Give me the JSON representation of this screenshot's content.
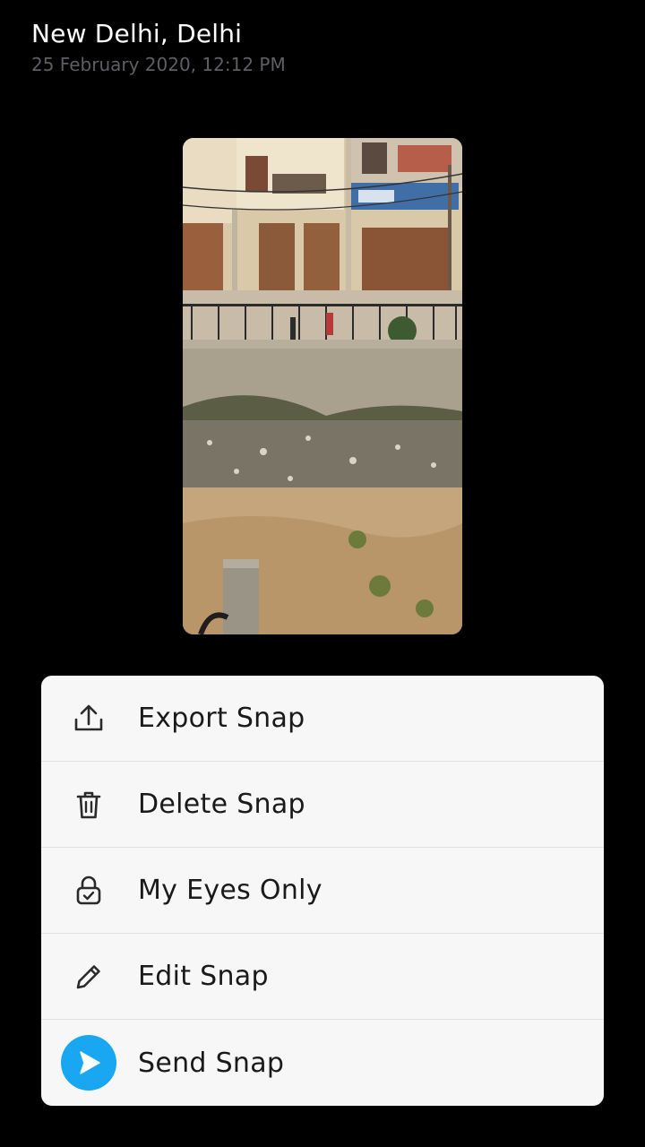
{
  "header": {
    "location": "New Delhi, Delhi",
    "timestamp": "25 February 2020, 12:12 PM"
  },
  "snap": {
    "alt": "Snap photo of a street with shuttered shops, a railing and a dusty lot"
  },
  "actions": [
    {
      "label": "Export Snap",
      "icon": "export-icon"
    },
    {
      "label": "Delete Snap",
      "icon": "trash-icon"
    },
    {
      "label": "My Eyes Only",
      "icon": "lock-icon"
    },
    {
      "label": "Edit Snap",
      "icon": "pencil-icon"
    },
    {
      "label": "Send Snap",
      "icon": "send-icon"
    }
  ],
  "colors": {
    "background": "#000000",
    "sheet": "#f7f7f7",
    "send_accent": "#1aa7f2",
    "timestamp": "#5e5e63"
  }
}
